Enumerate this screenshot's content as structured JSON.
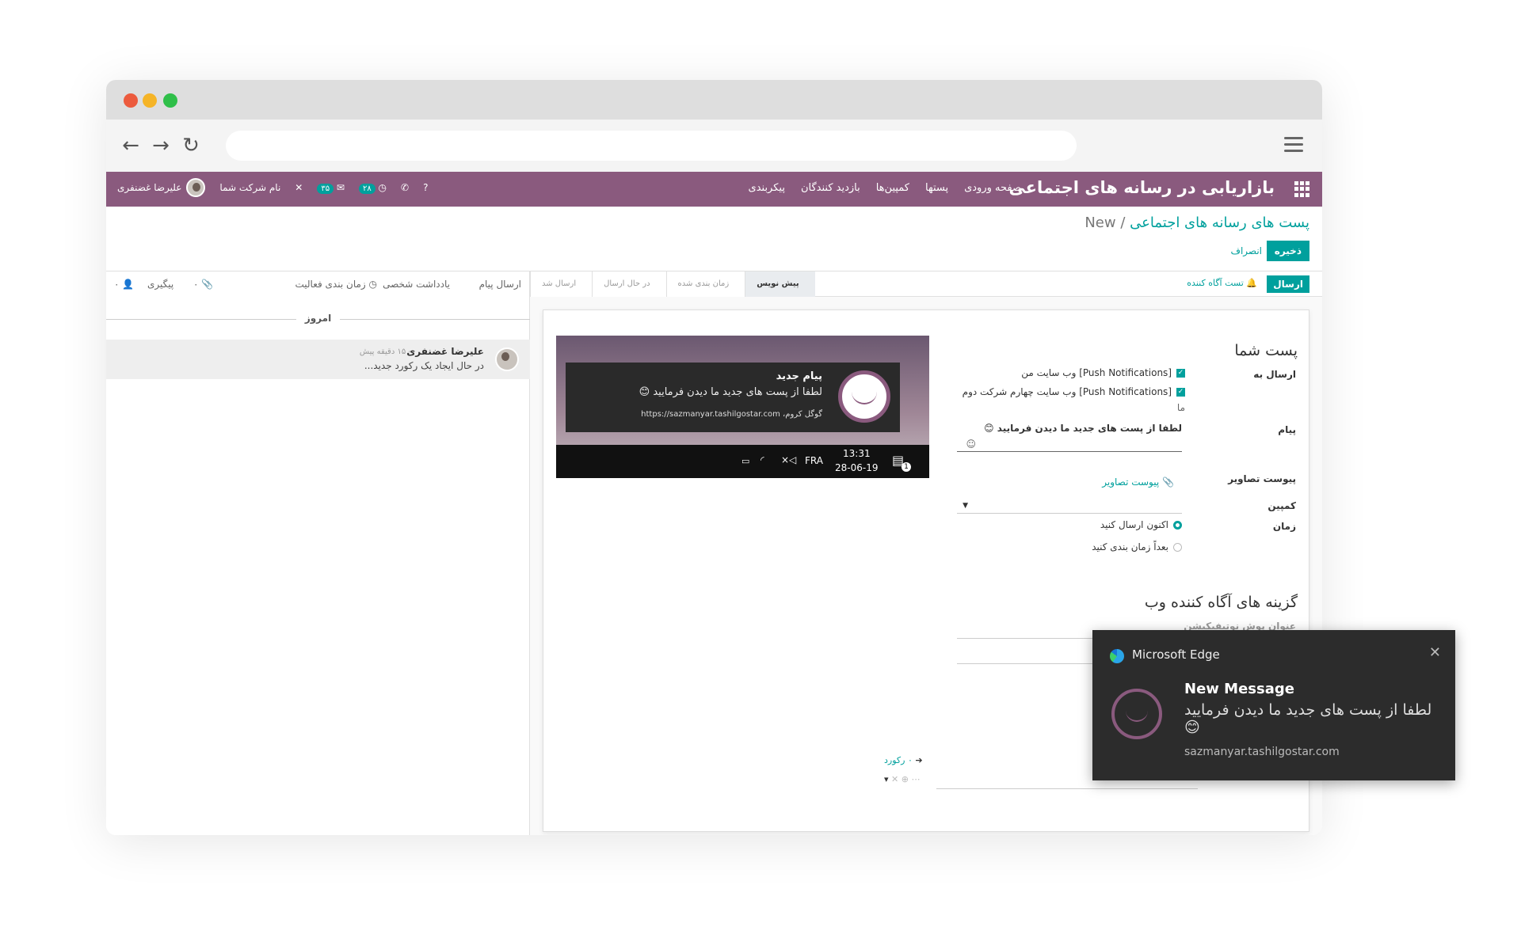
{
  "app": {
    "brand": "بازاریابی در رسانه های اجتماعی",
    "menu": [
      "صفحه ورودی",
      "پستها",
      "کمپین‌ها",
      "بازدید کنندگان",
      "پیکربندی"
    ],
    "badge_activity": "۲۸",
    "badge_messages": "۳۵",
    "company": "نام شرکت شما",
    "user": "علیرضا غضنفری"
  },
  "control": {
    "breadcrumb_parent": "پست های رسانه های اجتماعی",
    "breadcrumb_sep": "/",
    "breadcrumb_current": "New",
    "save": "ذخیره",
    "discard": "انصراف"
  },
  "status": {
    "send": "ارسال",
    "test": "تست آگاه کننده",
    "stages": [
      "پیش نویس",
      "زمان بندی شده",
      "در حال ارسال",
      "ارسال شد"
    ],
    "active_stage": "پیش نویس"
  },
  "form": {
    "section_post": "پست شما",
    "send_to_label": "ارسال به",
    "send_to_1": "[Push Notifications] وب سایت من",
    "send_to_2": "[Push Notifications] وب سایت چهارم شرکت دوم",
    "send_to_2b": "ما",
    "message_label": "پیام",
    "message_value": "لطفا از پست های جدید ما دیدن فرمایید 😊",
    "emoji": "☺",
    "attach_label": "پیوست تصاویر",
    "attach_link": "پیوست تصاویر",
    "campaign_label": "کمپین",
    "time_label": "زمان",
    "time_now": "اکنون ارسال کنید",
    "time_later": "بعداً زمان بندی کنید",
    "section_web": "گزینه های آگاه کننده وب",
    "push_title_label": "عنوان پوش نوتیفیکیشن",
    "record_link": "۰ رکورد"
  },
  "preview": {
    "title": "پیام جدید",
    "body": "لطفا از پست های جدید ما دیدن فرمایید 😊",
    "url": "https://sazmanyar.tashilgostar.com",
    "browser": "گوگل کروم،",
    "lang": "FRA",
    "time": "13:31",
    "date": "28-06-19",
    "notif_count": "1"
  },
  "chatter": {
    "send_message": "ارسال پیام",
    "log_note": "یادداشت شخصی",
    "schedule": "زمان بندی فعالیت",
    "attachments": "۰",
    "follow": "پیگیری",
    "followers": "۰",
    "today": "امروز",
    "author": "علیرضا غضنفری",
    "ago": "- ۱۵ دقیقه پیش",
    "text": "در حال ایجاد یک رکورد جدید..."
  },
  "edge_toast": {
    "app": "Microsoft Edge",
    "close": "✕",
    "heading": "New Message",
    "body": "لطفا از پست های جدید ما دیدن فرمایید 😊",
    "source": "sazmanyar.tashilgostar.com"
  }
}
